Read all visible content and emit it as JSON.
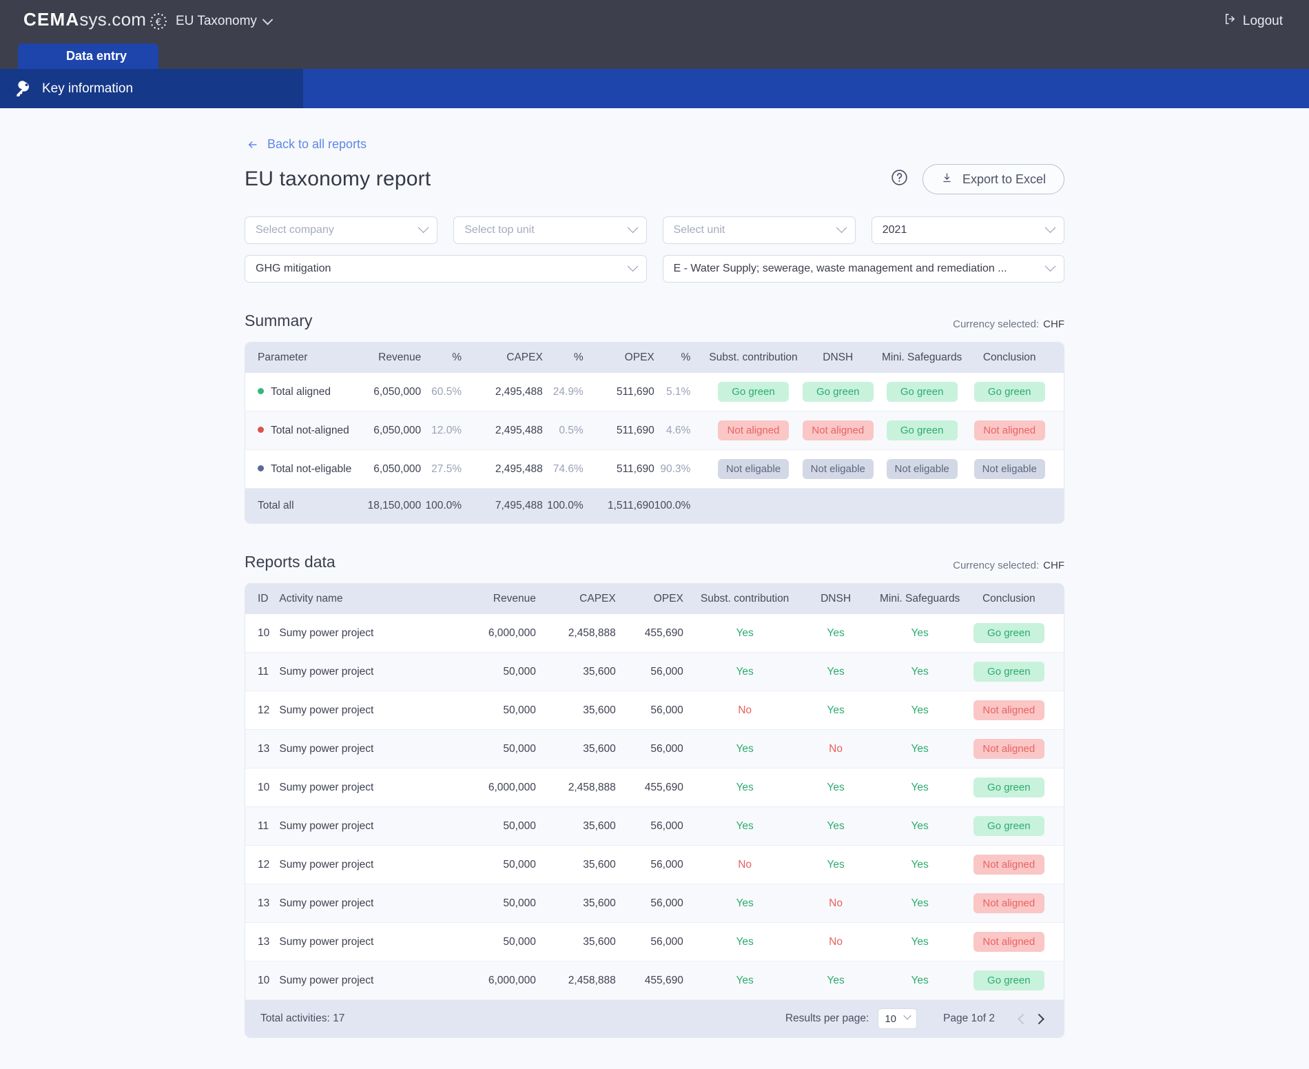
{
  "header": {
    "brand_bold": "CEMA",
    "brand_light": "sys.com",
    "module": "EU Taxonomy",
    "logout": "Logout",
    "tab": "Data entry",
    "subnav_item": "Key information"
  },
  "page": {
    "back_link": "Back to all reports",
    "title": "EU taxonomy report",
    "export_label": "Export to Excel"
  },
  "filters": {
    "company_placeholder": "Select company",
    "top_unit_placeholder": "Select top unit",
    "unit_placeholder": "Select unit",
    "year_value": "2021",
    "objective_value": "GHG mitigation",
    "nace_value": "E - Water Supply; sewerage, waste management and remediation ..."
  },
  "summary": {
    "section_title": "Summary",
    "currency_label": "Currency selected:",
    "currency_value": "CHF",
    "columns": [
      "Parameter",
      "Revenue",
      "%",
      "CAPEX",
      "%",
      "OPEX",
      "%",
      "Subst. contribution",
      "DNSH",
      "Mini. Safeguards",
      "Conclusion"
    ],
    "rows": [
      {
        "dot": "green",
        "parameter": "Total aligned",
        "revenue": "6,050,000",
        "revenue_pct": "60.5%",
        "capex": "2,495,488",
        "capex_pct": "24.9%",
        "opex": "511,690",
        "opex_pct": "5.1%",
        "subst": "Go green",
        "subst_type": "green",
        "dnsh": "Go green",
        "dnsh_type": "green",
        "safeguards": "Go green",
        "safeguards_type": "green",
        "conclusion": "Go green",
        "conclusion_type": "green"
      },
      {
        "dot": "red",
        "parameter": "Total not-aligned",
        "revenue": "6,050,000",
        "revenue_pct": "12.0%",
        "capex": "2,495,488",
        "capex_pct": "0.5%",
        "opex": "511,690",
        "opex_pct": "4.6%",
        "subst": "Not aligned",
        "subst_type": "red",
        "dnsh": "Not aligned",
        "dnsh_type": "red",
        "safeguards": "Go green",
        "safeguards_type": "green",
        "conclusion": "Not aligned",
        "conclusion_type": "red"
      },
      {
        "dot": "blue",
        "parameter": "Total not-eligable",
        "revenue": "6,050,000",
        "revenue_pct": "27.5%",
        "capex": "2,495,488",
        "capex_pct": "74.6%",
        "opex": "511,690",
        "opex_pct": "90.3%",
        "subst": "Not eligable",
        "subst_type": "grey",
        "dnsh": "Not eligable",
        "dnsh_type": "grey",
        "safeguards": "Not eligable",
        "safeguards_type": "grey",
        "conclusion": "Not eligable",
        "conclusion_type": "grey"
      }
    ],
    "total": {
      "parameter": "Total all",
      "revenue": "18,150,000",
      "revenue_pct": "100.0%",
      "capex": "7,495,488",
      "capex_pct": "100.0%",
      "opex": "1,511,690",
      "opex_pct": "100.0%"
    }
  },
  "reports": {
    "section_title": "Reports data",
    "currency_label": "Currency selected:",
    "currency_value": "CHF",
    "columns": [
      "ID",
      "Activity name",
      "Revenue",
      "CAPEX",
      "OPEX",
      "Subst. contribution",
      "DNSH",
      "Mini. Safeguards",
      "Conclusion"
    ],
    "rows": [
      {
        "id": "10",
        "activity": "Sumy power project",
        "revenue": "6,000,000",
        "capex": "2,458,888",
        "opex": "455,690",
        "subst": "Yes",
        "dnsh": "Yes",
        "safeguards": "Yes",
        "conclusion": "Go green",
        "conclusion_type": "green"
      },
      {
        "id": "11",
        "activity": "Sumy power project",
        "revenue": "50,000",
        "capex": "35,600",
        "opex": "56,000",
        "subst": "Yes",
        "dnsh": "Yes",
        "safeguards": "Yes",
        "conclusion": "Go green",
        "conclusion_type": "green"
      },
      {
        "id": "12",
        "activity": "Sumy power project",
        "revenue": "50,000",
        "capex": "35,600",
        "opex": "56,000",
        "subst": "No",
        "dnsh": "Yes",
        "safeguards": "Yes",
        "conclusion": "Not aligned",
        "conclusion_type": "red"
      },
      {
        "id": "13",
        "activity": "Sumy power project",
        "revenue": "50,000",
        "capex": "35,600",
        "opex": "56,000",
        "subst": "Yes",
        "dnsh": "No",
        "safeguards": "Yes",
        "conclusion": "Not aligned",
        "conclusion_type": "red"
      },
      {
        "id": "10",
        "activity": "Sumy power project",
        "revenue": "6,000,000",
        "capex": "2,458,888",
        "opex": "455,690",
        "subst": "Yes",
        "dnsh": "Yes",
        "safeguards": "Yes",
        "conclusion": "Go green",
        "conclusion_type": "green"
      },
      {
        "id": "11",
        "activity": "Sumy power project",
        "revenue": "50,000",
        "capex": "35,600",
        "opex": "56,000",
        "subst": "Yes",
        "dnsh": "Yes",
        "safeguards": "Yes",
        "conclusion": "Go green",
        "conclusion_type": "green"
      },
      {
        "id": "12",
        "activity": "Sumy power project",
        "revenue": "50,000",
        "capex": "35,600",
        "opex": "56,000",
        "subst": "No",
        "dnsh": "Yes",
        "safeguards": "Yes",
        "conclusion": "Not aligned",
        "conclusion_type": "red"
      },
      {
        "id": "13",
        "activity": "Sumy power project",
        "revenue": "50,000",
        "capex": "35,600",
        "opex": "56,000",
        "subst": "Yes",
        "dnsh": "No",
        "safeguards": "Yes",
        "conclusion": "Not aligned",
        "conclusion_type": "red"
      },
      {
        "id": "13",
        "activity": "Sumy power project",
        "revenue": "50,000",
        "capex": "35,600",
        "opex": "56,000",
        "subst": "Yes",
        "dnsh": "No",
        "safeguards": "Yes",
        "conclusion": "Not aligned",
        "conclusion_type": "red"
      },
      {
        "id": "10",
        "activity": "Sumy power project",
        "revenue": "6,000,000",
        "capex": "2,458,888",
        "opex": "455,690",
        "subst": "Yes",
        "dnsh": "Yes",
        "safeguards": "Yes",
        "conclusion": "Go green",
        "conclusion_type": "green"
      }
    ],
    "footer": {
      "total_activities": "Total activities: 17",
      "results_per_page_label": "Results per page:",
      "results_per_page_value": "10",
      "page_indicator": "Page 1of 2"
    }
  },
  "colors": {
    "accent_blue": "#1e45ac",
    "green": "#2cab6f",
    "red": "#e86464",
    "grey": "#5e667e"
  }
}
